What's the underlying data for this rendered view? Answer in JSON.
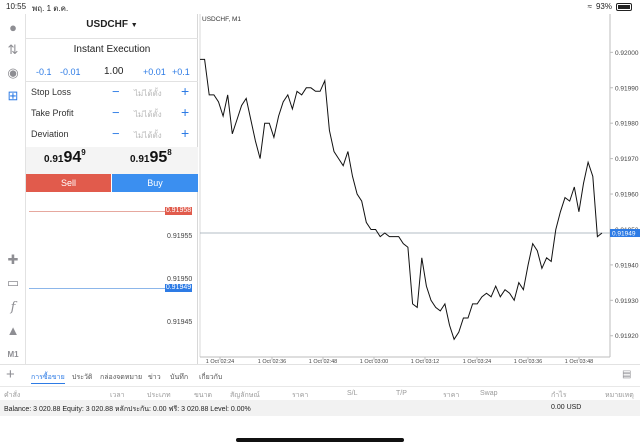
{
  "status": {
    "time": "10:55",
    "date": "พฤ. 1 ต.ค.",
    "battery": "93%"
  },
  "trade": {
    "symbol": "USDCHF",
    "mode": "Instant Execution",
    "lots": [
      "-0.1",
      "-0.01",
      "1.00",
      "+0.01",
      "+0.1"
    ],
    "fields": [
      {
        "label": "Stop Loss",
        "placeholder": "ไม่ได้ตั้ง"
      },
      {
        "label": "Take Profit",
        "placeholder": "ไม่ได้ตั้ง"
      },
      {
        "label": "Deviation",
        "placeholder": "ไม่ได้ตั้ง"
      }
    ],
    "bid": {
      "prefix": "0.91",
      "big": "94",
      "sup": "9"
    },
    "ask": {
      "prefix": "0.91",
      "big": "95",
      "sup": "8"
    },
    "sell_label": "Sell",
    "buy_label": "Buy",
    "ask_tag": "0.91958",
    "bid_tag": "0.91949",
    "depth_ticks": [
      "0.91955",
      "0.91950",
      "0.91945"
    ]
  },
  "chart_data": {
    "type": "line",
    "title": "USDCHF, M1",
    "ylim": [
      0.91914,
      0.92008
    ],
    "y_ticks": [
      0.9192,
      0.9193,
      0.9194,
      0.9195,
      0.9196,
      0.9197,
      0.9198,
      0.9199,
      0.92
    ],
    "y_tick_labels": [
      "0.91920",
      "0.91930",
      "0.91940",
      "0.91950",
      "0.91960",
      "0.91970",
      "0.91980",
      "0.91990",
      "0.92000"
    ],
    "x_tick_labels": [
      "1 Oct 02:24",
      "1 Oct 02:36",
      "1 Oct 02:48",
      "1 Oct 03:00",
      "1 Oct 03:12",
      "1 Oct 03:24",
      "1 Oct 03:36",
      "1 Oct 03:48"
    ],
    "bid_level": 0.91949,
    "bid_label": "0.91949",
    "grid": false,
    "series": [
      {
        "values": [
          0.91998,
          0.91998,
          0.91988,
          0.91988,
          0.91986,
          0.91982,
          0.91988,
          0.91977,
          0.91981,
          0.91985,
          0.91987,
          0.91981,
          0.91975,
          0.9197,
          0.9198,
          0.9198,
          0.91976,
          0.91982,
          0.91986,
          0.91988,
          0.91984,
          0.91989,
          0.91988,
          0.9199,
          0.9199,
          0.91989,
          0.91989,
          0.91992,
          0.91978,
          0.91972,
          0.9197,
          0.91968,
          0.91972,
          0.91965,
          0.9196,
          0.91958,
          0.91952,
          0.9195,
          0.9195,
          0.91948,
          0.91949,
          0.91948,
          0.91948,
          0.91948,
          0.91946,
          0.91945,
          0.91929,
          0.91928,
          0.91942,
          0.91934,
          0.9193,
          0.91928,
          0.91927,
          0.91929,
          0.91923,
          0.91919,
          0.91921,
          0.91925,
          0.91925,
          0.91929,
          0.91929,
          0.91931,
          0.91932,
          0.91931,
          0.91934,
          0.91931,
          0.91933,
          0.91932,
          0.9193,
          0.91935,
          0.91933,
          0.9194,
          0.91946,
          0.91944,
          0.91939,
          0.91942,
          0.91941,
          0.9195,
          0.91955,
          0.91959,
          0.91958,
          0.91962,
          0.91955,
          0.91963,
          0.91969,
          0.91965,
          0.91948,
          0.91949
        ]
      }
    ]
  },
  "bottom": {
    "tabs": [
      "การซื้อขาย",
      "ประวัติ",
      "กล่องจดหมาย",
      "ข่าว",
      "บันทึก",
      "เกี่ยวกับ"
    ],
    "columns": [
      "คำสั่ง",
      "เวลา",
      "ประเภท",
      "ขนาด",
      "สัญลักษณ์",
      "ราคา",
      "S/L",
      "T/P",
      "ราคา",
      "Swap",
      "กำไร",
      "หมายเหตุ"
    ],
    "balance_line": "Balance: 3 020.88 Equity: 3 020.88 หลักประกัน: 0.00 ฟรี: 3 020.88 Level: 0.00%",
    "total": "0.00  USD"
  }
}
